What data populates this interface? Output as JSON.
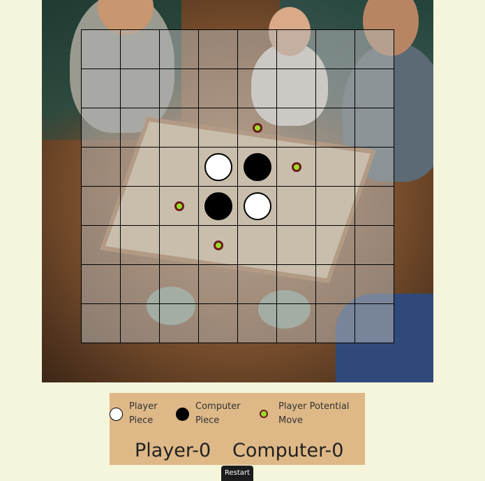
{
  "board": {
    "size": 8,
    "pieces": [
      {
        "row": 2,
        "col": 4,
        "type": "hint"
      },
      {
        "row": 3,
        "col": 3,
        "type": "player"
      },
      {
        "row": 3,
        "col": 4,
        "type": "computer"
      },
      {
        "row": 3,
        "col": 5,
        "type": "hint"
      },
      {
        "row": 4,
        "col": 2,
        "type": "hint"
      },
      {
        "row": 4,
        "col": 3,
        "type": "computer"
      },
      {
        "row": 4,
        "col": 4,
        "type": "player"
      },
      {
        "row": 5,
        "col": 3,
        "type": "hint"
      }
    ],
    "colors": {
      "player": "#ffffff",
      "computer": "#000000",
      "hint_fill": "#9bdc2b",
      "hint_ring": "#6b1a1a"
    }
  },
  "legend": {
    "player_label": "Player Piece",
    "computer_label": "Computer Piece",
    "hint_label": "Player Potential Move"
  },
  "score": {
    "player": "Player-0",
    "computer": "Computer-0"
  },
  "restart_label": "Restart"
}
